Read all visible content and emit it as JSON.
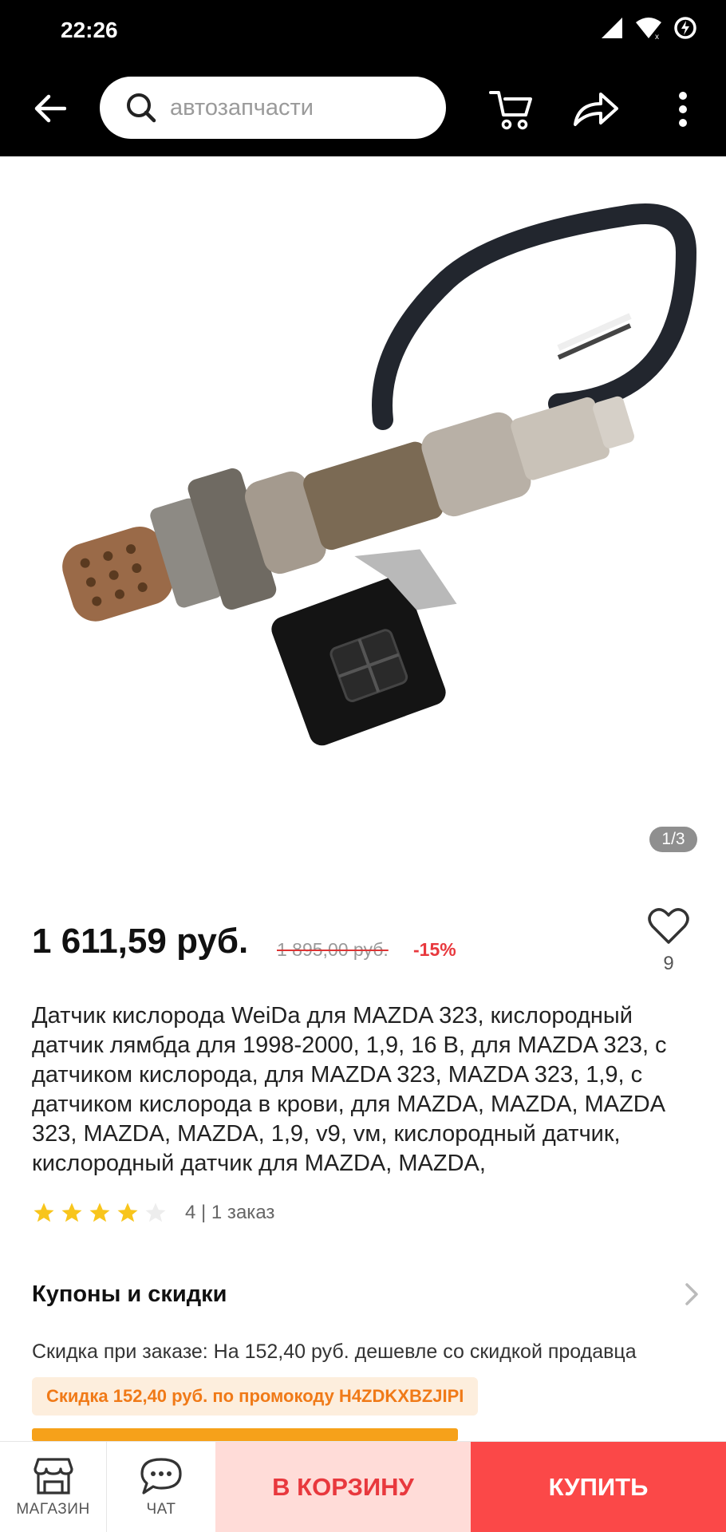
{
  "status_bar": {
    "time": "22:26"
  },
  "toolbar": {
    "search_placeholder": "автозапчасти"
  },
  "gallery": {
    "counter": "1/3"
  },
  "product": {
    "price": "1 611,59 руб.",
    "old_price": "1 895,00 руб.",
    "discount": "-15%",
    "favorites_count": "9",
    "title": "Датчик кислорода WeiDa для MAZDA 323, кислородный датчик лямбда для 1998-2000, 1,9, 16 В, для MAZDA 323, с датчиком кислорода, для MAZDA 323, MAZDA 323, 1,9, с датчиком кислорода в крови, для MAZDA, MAZDA, MAZDA 323, MAZDA, MAZDA, 1,9, v9, vм, кислородный датчик, кислородный датчик для MAZDA, MAZDA,",
    "rating": 4,
    "rating_text": "4 | 1 заказ"
  },
  "coupons": {
    "title": "Купоны и скидки",
    "discount_line": "Скидка при заказе: На 152,40 руб. дешевле со скидкой продавца",
    "promo": "Скидка 152,40 руб. по промокоду H4ZDKXBZJIPI"
  },
  "bottom_bar": {
    "store_label": "МАГАЗИН",
    "chat_label": "ЧАТ",
    "cart_label": "В КОРЗИНУ",
    "buy_label": "КУПИТЬ"
  },
  "colors": {
    "accent_red": "#fb4848",
    "cart_bg": "#ffdcd8",
    "promo_orange": "#f07a18",
    "star": "#f8c51c"
  }
}
